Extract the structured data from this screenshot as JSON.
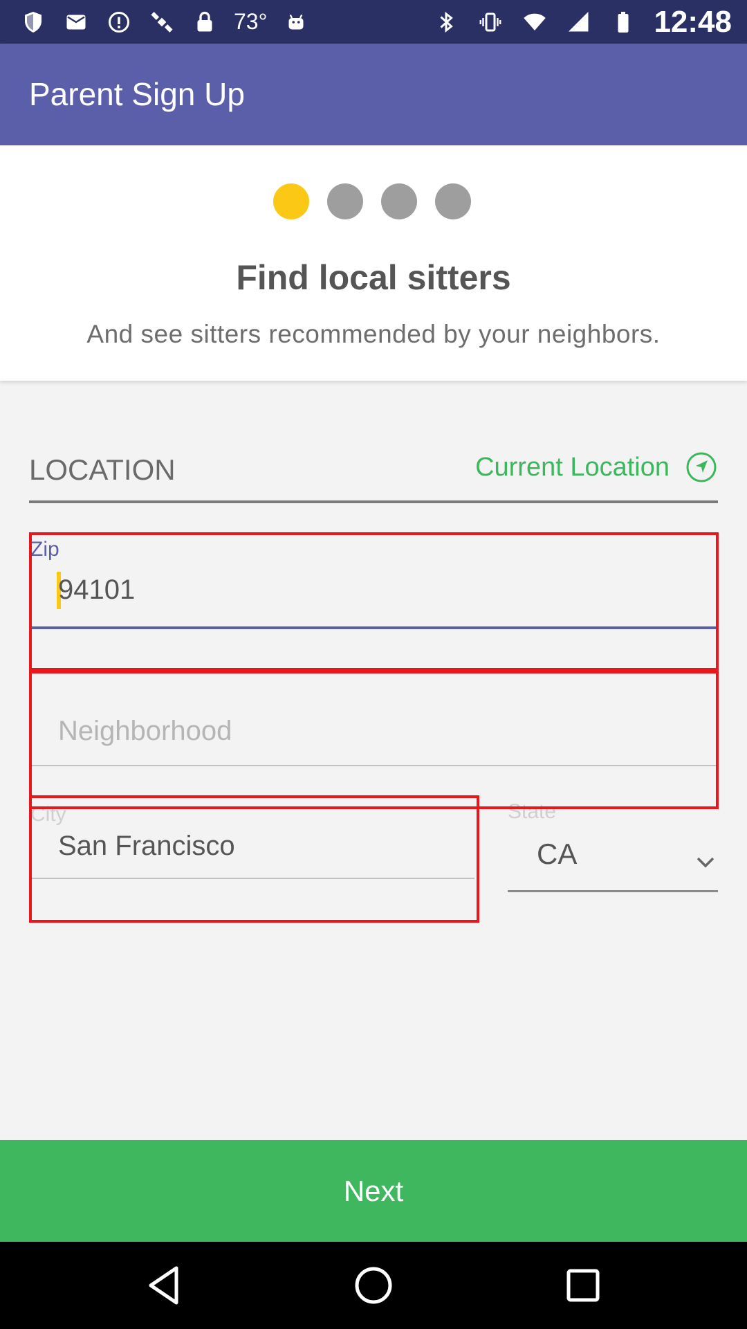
{
  "status_bar": {
    "temperature": "73°",
    "time": "12:48",
    "left_icons": [
      "shield-icon",
      "mail-icon",
      "alert-circle-icon",
      "satellite-icon",
      "lock-icon",
      "android-icon"
    ],
    "right_icons": [
      "bluetooth-icon",
      "vibrate-icon",
      "wifi-icon",
      "signal-icon",
      "battery-icon"
    ]
  },
  "app_bar": {
    "title": "Parent Sign Up"
  },
  "intro": {
    "step_current": 1,
    "step_total": 4,
    "title": "Find local sitters",
    "subtitle": "And see sitters recommended by your neighbors."
  },
  "location": {
    "label": "LOCATION",
    "current_location_label": "Current Location"
  },
  "form": {
    "zip": {
      "label": "Zip",
      "value": "94101"
    },
    "neighborhood": {
      "placeholder": "Neighborhood"
    },
    "city": {
      "label": "City",
      "value": "San Francisco"
    },
    "state": {
      "label": "State",
      "value": "CA"
    }
  },
  "next_button": {
    "label": "Next"
  },
  "colors": {
    "status_bar": "#2a2f64",
    "app_bar": "#5b5ea8",
    "accent_yellow": "#fbc915",
    "green": "#3eb75e",
    "highlight_red": "#e8171b"
  }
}
